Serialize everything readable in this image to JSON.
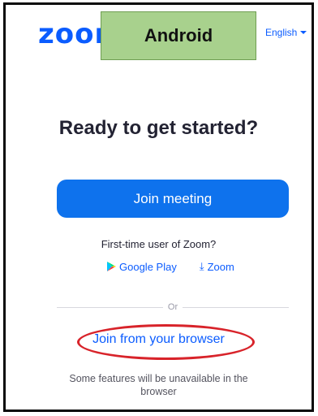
{
  "header": {
    "logo_text": "zoom",
    "annotation_label": "Android",
    "language": "English"
  },
  "main": {
    "title": "Ready to get started?",
    "join_button": "Join meeting",
    "first_time_text": "First-time user of Zoom?",
    "google_play": "Google Play",
    "zoom_download": "Zoom",
    "divider_text": "Or",
    "browser_link": "Join from your browser",
    "note": "Some features will be unavailable in the browser"
  },
  "colors": {
    "brand_blue": "#0b5cff",
    "button_blue": "#0e72ed",
    "annotation_green": "#a8d18d",
    "annotation_red": "#d8232a"
  }
}
